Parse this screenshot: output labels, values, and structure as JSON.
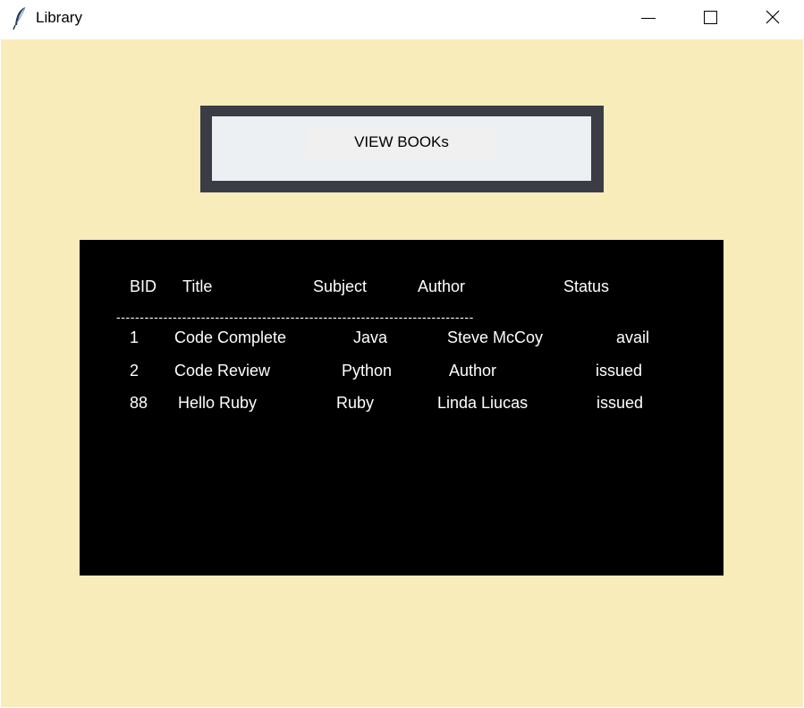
{
  "window": {
    "title": "Library",
    "icon": "feather-icon",
    "controls": {
      "minimize": "minimize-icon",
      "maximize": "maximize-icon",
      "close": "close-icon"
    }
  },
  "heading": {
    "label": "VIEW BOOKs"
  },
  "table": {
    "headers": {
      "bid": "BID",
      "title": "Title",
      "subject": "Subject",
      "author": "Author",
      "status": "Status"
    },
    "divider": "----------------------------------------------------------------------------",
    "rows": [
      {
        "bid": "1",
        "title": "Code Complete",
        "subject": "Java",
        "author": "Steve McCoy",
        "status": "avail"
      },
      {
        "bid": "2",
        "title": "Code Review",
        "subject": "Python",
        "author": "Author",
        "status": "issued"
      },
      {
        "bid": "88",
        "title": "Hello Ruby",
        "subject": "Ruby",
        "author": "Linda Liucas",
        "status": "issued"
      }
    ]
  },
  "colors": {
    "background": "#f9ecbb",
    "heading_frame": "#3a3d45",
    "heading_inner": "#edf0f3",
    "table_background": "#000000",
    "table_text": "#ffffff"
  }
}
